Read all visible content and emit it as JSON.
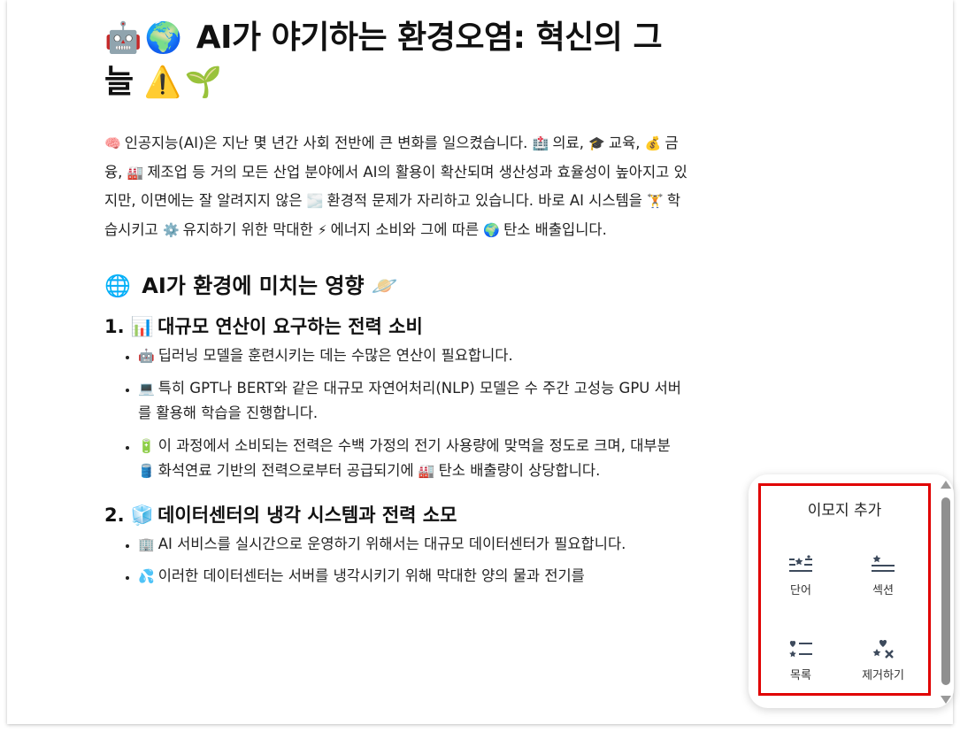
{
  "doc": {
    "title": "AI가 야기하는 환경오염: 혁신의 그늘",
    "title_emoji_left": [
      "🤖",
      "🌍"
    ],
    "title_emoji_right": [
      "⚠️",
      "🌱"
    ],
    "intro": [
      {
        "emoji": "🧠",
        "text": "인공지능(AI)은 지난 몇 년간 사회 전반에 큰 변화를 일으켰습니다."
      },
      {
        "emoji": "🏥",
        "text": "의료,"
      },
      {
        "emoji": "🎓",
        "text": "교육,"
      },
      {
        "emoji": "💰",
        "text": "금융,"
      },
      {
        "emoji": "🏭",
        "text": "제조업 등 거의 모든 산업 분야에서 AI의 활용이 확산되며 생산성과 효율성이 높아지고 있지만, 이면에는 잘 알려지지 않은"
      },
      {
        "emoji": "🌫️",
        "text": "환경적 문제가 자리하고 있습니다. 바로 AI 시스템을"
      },
      {
        "emoji": "🏋️",
        "text": "학습시키고"
      },
      {
        "emoji": "⚙️",
        "text": "유지하기 위한 막대한"
      },
      {
        "emoji": "⚡",
        "text": "에너지 소비와 그에 따른"
      },
      {
        "emoji": "🌍",
        "text": "탄소 배출입니다."
      }
    ],
    "section": {
      "emoji": "🌐",
      "title": "AI가 환경에 미치는 영향",
      "emoji_after": "🪐"
    },
    "sub1": {
      "num": "1.",
      "emoji": "📊",
      "title": "대규모 연산이 요구하는 전력 소비",
      "items": [
        {
          "emoji": "🤖",
          "text": "딥러닝 모델을 훈련시키는 데는 수많은 연산이 필요합니다."
        },
        {
          "emoji": "💻",
          "text": "특히 GPT나 BERT와 같은 대규모 자연어처리(NLP) 모델은 수 주간 고성능 GPU 서버를 활용해 학습을 진행합니다."
        },
        {
          "emoji": "🔋",
          "text": "이 과정에서 소비되는 전력은 수백 가정의 전기 사용량에 맞먹을 정도로 크며, 대부분",
          "emoji2": "🛢️",
          "text2": "화석연료 기반의 전력으로부터 공급되기에",
          "emoji3": "🏭",
          "text3": "탄소 배출량이 상당합니다."
        }
      ]
    },
    "sub2": {
      "num": "2.",
      "emoji": "🧊",
      "title": "데이터센터의 냉각 시스템과 전력 소모",
      "items": [
        {
          "emoji": "🏢",
          "text": "AI 서비스를 실시간으로 운영하기 위해서는 대규모 데이터센터가 필요합니다."
        },
        {
          "emoji": "💦",
          "text": "이러한 데이터센터는 서버를 냉각시키기 위해 막대한 양의 물과 전기를"
        }
      ]
    }
  },
  "emoji_panel": {
    "title": "이모지 추가",
    "options": [
      {
        "label": "단어",
        "icon": "word-emoji-icon"
      },
      {
        "label": "섹션",
        "icon": "section-emoji-icon"
      },
      {
        "label": "목록",
        "icon": "list-emoji-icon"
      },
      {
        "label": "제거하기",
        "icon": "remove-emoji-icon"
      }
    ],
    "highlight_color": "#e00000"
  }
}
